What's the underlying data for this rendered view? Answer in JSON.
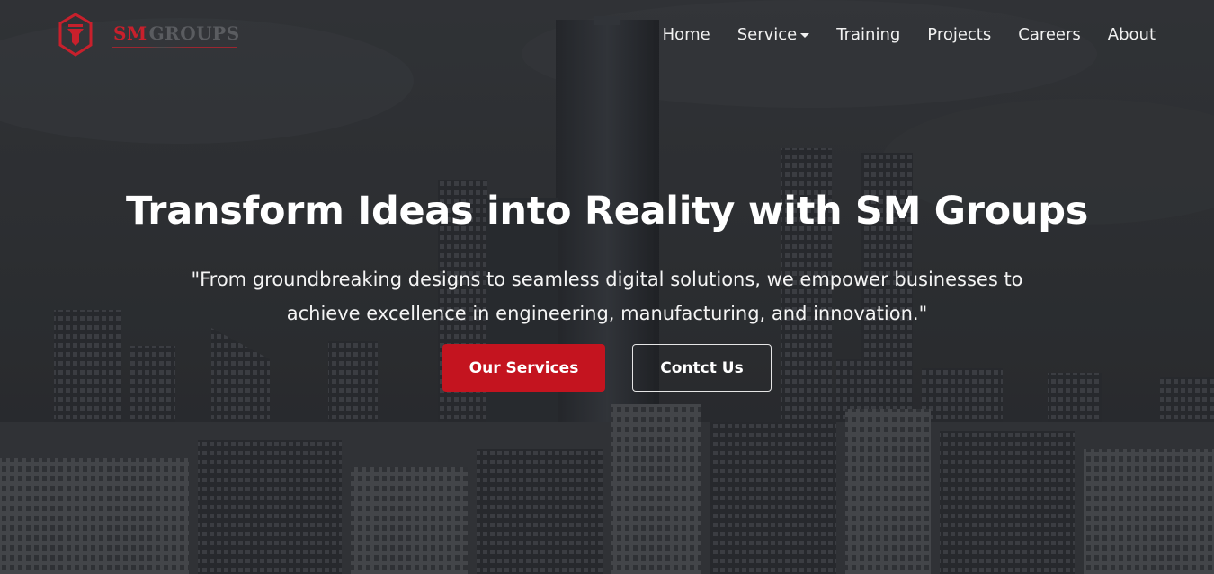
{
  "brand": {
    "name_part1": "SM",
    "name_part2": "GROUPS",
    "icon": "shield-logo-icon",
    "accent_color": "#c8202c"
  },
  "nav": {
    "items": [
      {
        "label": "Home"
      },
      {
        "label": "Service",
        "has_dropdown": true
      },
      {
        "label": "Training"
      },
      {
        "label": "Projects"
      },
      {
        "label": "Careers"
      },
      {
        "label": "About"
      }
    ]
  },
  "hero": {
    "title": "Transform Ideas into Reality with SM Groups",
    "subtitle": "\"From groundbreaking designs to seamless digital solutions, we empower businesses to achieve excellence in engineering, manufacturing, and innovation.\"",
    "primary_button": "Our Services",
    "secondary_button": "Contct Us",
    "primary_color": "#c4141f",
    "background": "city-skyline-image"
  }
}
